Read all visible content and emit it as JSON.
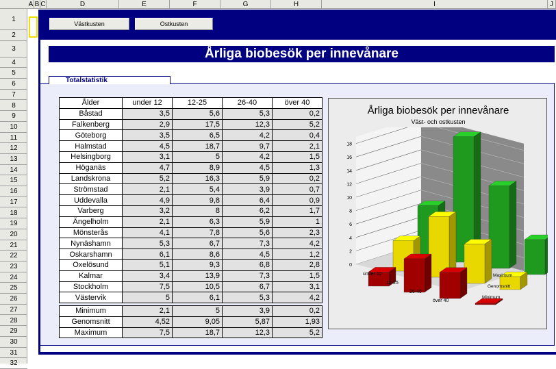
{
  "columns": [
    "A",
    "B",
    "C",
    "D",
    "E",
    "F",
    "G",
    "H",
    "I",
    "J"
  ],
  "rows": [
    "1",
    "2",
    "3",
    "4",
    "5",
    "6",
    "7",
    "8",
    "9",
    "10",
    "11",
    "12",
    "13",
    "14",
    "15",
    "16",
    "17",
    "18",
    "19",
    "20",
    "21",
    "22",
    "23",
    "24",
    "25",
    "26",
    "27",
    "28",
    "29",
    "30",
    "31",
    "32"
  ],
  "buttons": {
    "west": "Västkusten",
    "east": "Ostkusten"
  },
  "banner_title": "Årliga biobesök per innevånare",
  "tab_label": "Totalstatistik",
  "table": {
    "headers": [
      "Ålder",
      "under 12",
      "12-25",
      "26-40",
      "över 40"
    ],
    "rows": [
      [
        "Båstad",
        "3,5",
        "5,6",
        "5,3",
        "0,2"
      ],
      [
        "Falkenberg",
        "2,9",
        "17,5",
        "12,3",
        "5,2"
      ],
      [
        "Göteborg",
        "3,5",
        "6,5",
        "4,2",
        "0,4"
      ],
      [
        "Halmstad",
        "4,5",
        "18,7",
        "9,7",
        "2,1"
      ],
      [
        "Helsingborg",
        "3,1",
        "5",
        "4,2",
        "1,5"
      ],
      [
        "Höganäs",
        "4,7",
        "8,9",
        "4,5",
        "1,3"
      ],
      [
        "Landskrona",
        "5,2",
        "16,3",
        "5,9",
        "0,2"
      ],
      [
        "Strömstad",
        "2,1",
        "5,4",
        "3,9",
        "0,7"
      ],
      [
        "Uddevalla",
        "4,9",
        "9,8",
        "6,4",
        "0,9"
      ],
      [
        "Varberg",
        "3,2",
        "8",
        "6,2",
        "1,7"
      ],
      [
        "Ängelholm",
        "2,1",
        "6,3",
        "5,9",
        "1"
      ],
      [
        "Mönsterås",
        "4,1",
        "7,8",
        "5,6",
        "2,3"
      ],
      [
        "Nynäshamn",
        "5,3",
        "6,7",
        "7,3",
        "4,2"
      ],
      [
        "Oskarshamn",
        "6,1",
        "8,6",
        "4,5",
        "1,2"
      ],
      [
        "Oxelösund",
        "5,1",
        "9,3",
        "6,8",
        "2,8"
      ],
      [
        "Kalmar",
        "3,4",
        "13,9",
        "7,3",
        "1,5"
      ],
      [
        "Stockholm",
        "7,5",
        "10,5",
        "6,7",
        "3,1"
      ],
      [
        "Västervik",
        "5",
        "6,1",
        "5,3",
        "4,2"
      ]
    ],
    "summary": [
      [
        "Minimum",
        "2,1",
        "5",
        "3,9",
        "0,2"
      ],
      [
        "Genomsnitt",
        "4,52",
        "9,05",
        "5,87",
        "1,93"
      ],
      [
        "Maximum",
        "7,5",
        "18,7",
        "12,3",
        "5,2"
      ]
    ]
  },
  "chart_data": {
    "type": "bar",
    "title": "Årliga biobesök per innevånare",
    "subtitle": "Väst- och ostkusten",
    "categories": [
      "under 12",
      "12-25",
      "26-40",
      "över 40"
    ],
    "series": [
      {
        "name": "Maximum",
        "values": [
          7.5,
          18.7,
          12.3,
          5.2
        ],
        "color": "#1f9a1f"
      },
      {
        "name": "Genomsnitt",
        "values": [
          4.52,
          9.05,
          5.87,
          1.93
        ],
        "color": "#e8d800"
      },
      {
        "name": "Minimum",
        "values": [
          2.1,
          5,
          3.9,
          0.2
        ],
        "color": "#a00000"
      }
    ],
    "yticks": [
      0,
      2,
      4,
      6,
      8,
      10,
      12,
      14,
      16,
      18
    ],
    "ylim": [
      0,
      19
    ],
    "legend": "depth-axis-right"
  }
}
